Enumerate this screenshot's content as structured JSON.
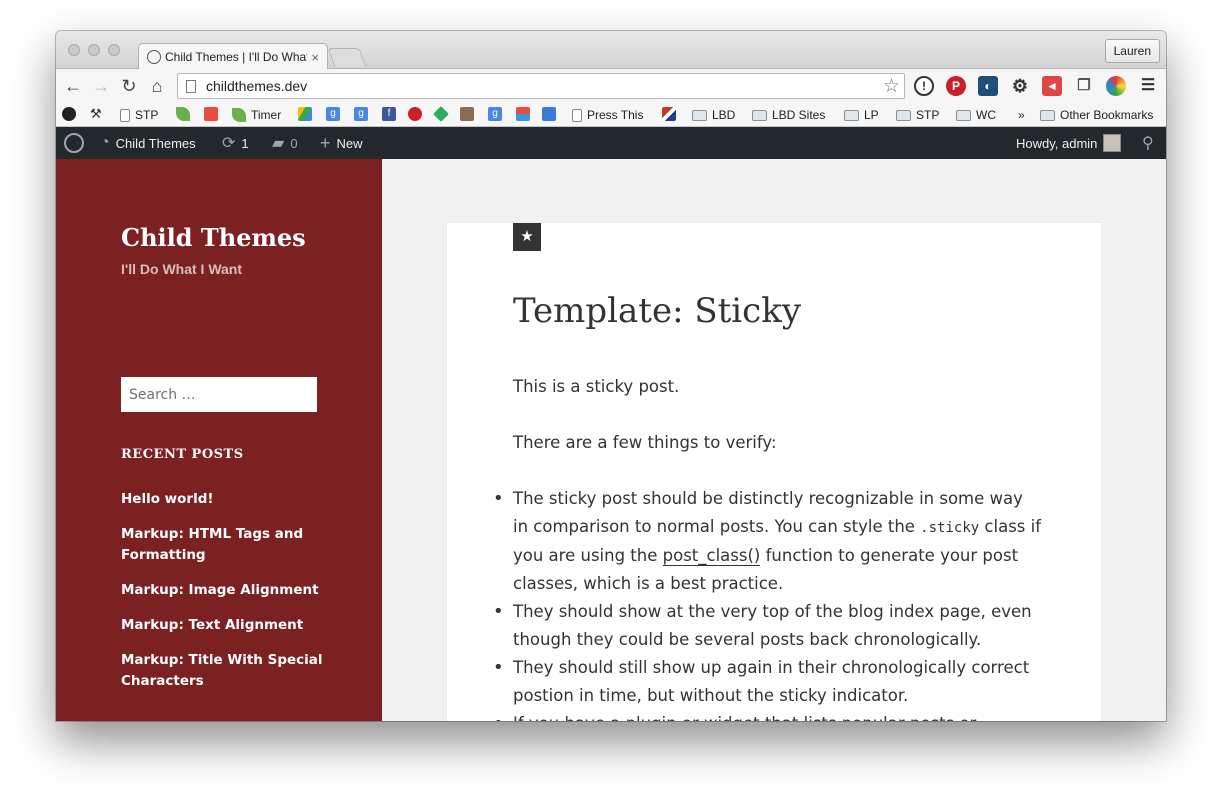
{
  "browser": {
    "tab_title": "Child Themes | I'll Do What",
    "tab_close": "×",
    "profile_name": "Lauren",
    "url": "childthemes.dev"
  },
  "bookmarks": {
    "stp1": "STP",
    "timer": "Timer",
    "press_this": "Press This",
    "lbd": "LBD",
    "lbd_sites": "LBD Sites",
    "lp": "LP",
    "stp2": "STP",
    "wc": "WC",
    "overflow": "»",
    "other": "Other Bookmarks"
  },
  "adminbar": {
    "site_name": "Child Themes",
    "updates_count": "1",
    "comments_count": "0",
    "new_label": "New",
    "howdy": "Howdy, admin"
  },
  "sidebar": {
    "site_title": "Child Themes",
    "site_description": "I'll Do What I Want",
    "search_placeholder": "Search …",
    "recent_posts_title": "RECENT POSTS",
    "recent_posts": [
      "Hello world!",
      "Markup: HTML Tags and Formatting",
      "Markup: Image Alignment",
      "Markup: Text Alignment",
      "Markup: Title With Special Characters"
    ]
  },
  "post": {
    "title": "Template: Sticky",
    "p1": "This is a sticky post.",
    "p2": "There are a few things to verify:",
    "li1_a": "The sticky post should be distinctly recognizable in some way in comparison to normal posts. You can style the ",
    "li1_code": ".sticky",
    "li1_b": " class if you are using the ",
    "li1_link": "post_class()",
    "li1_c": " function to generate your post classes, which is a best practice.",
    "li2": "They should show at the very top of the blog index page, even though they could be several posts back chronologically.",
    "li3": "They should still show up again in their chronologically correct postion in time, but without the sticky indicator.",
    "li4": "If you have a plugin or widget that lists popular posts or"
  },
  "colors": {
    "sidebar_bg": "#7b2122",
    "adminbar_bg": "#23282d",
    "page_bg": "#f1f1f1"
  }
}
